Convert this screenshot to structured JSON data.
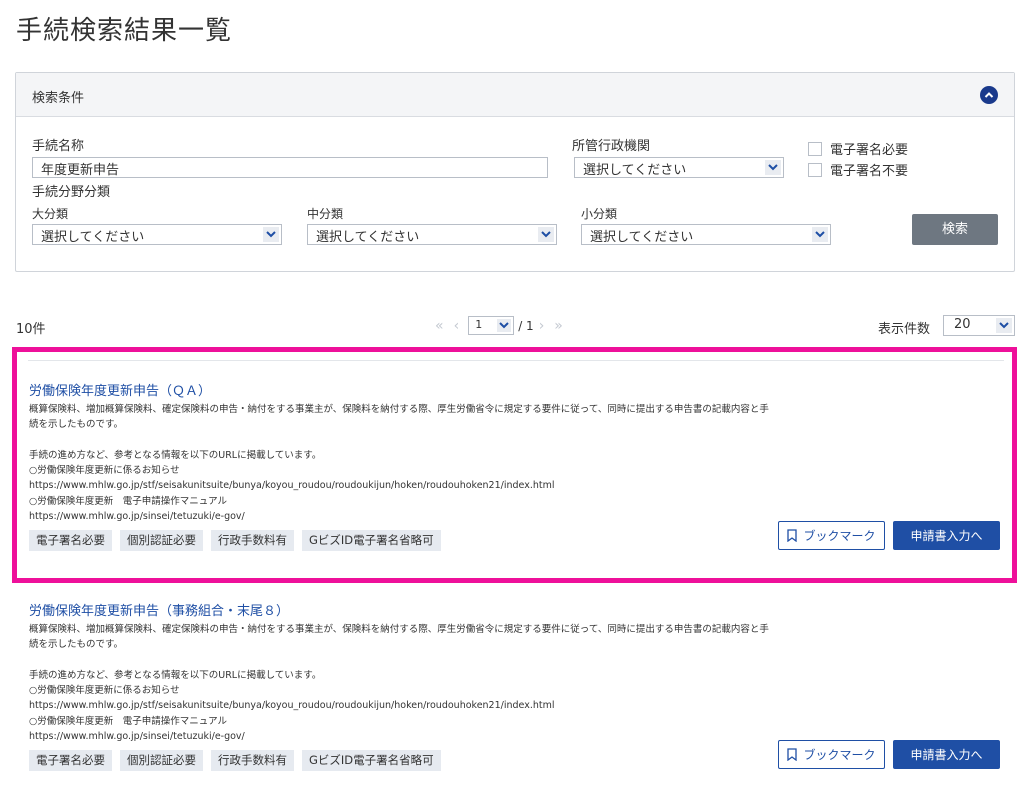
{
  "page_title": "手続検索結果一覧",
  "search_panel": {
    "title": "検索条件",
    "procedure_name_label": "手続名称",
    "procedure_name_value": "年度更新申告",
    "agency_label": "所管行政機関",
    "agency_value": "選択してください",
    "signature_required_label": "電子署名必要",
    "signature_not_required_label": "電子署名不要",
    "category_label": "手続分野分類",
    "major_label": "大分類",
    "major_value": "選択してください",
    "middle_label": "中分類",
    "middle_value": "選択してください",
    "minor_label": "小分類",
    "minor_value": "選択してください",
    "search_button": "検索"
  },
  "results_bar": {
    "count": "10件",
    "first_icon": "«",
    "prev_icon": "‹",
    "current_page": "1",
    "total_pages": "/ 1",
    "next_icon": "›",
    "last_icon": "»",
    "per_page_label": "表示件数",
    "per_page_value": "20"
  },
  "results": [
    {
      "title": "労働保険年度更新申告（ＱＡ）",
      "description": "概算保険料、増加概算保険料、確定保険料の申告・納付をする事業主が、保険料を納付する際、厚生労働省令に規定する要件に従って、同時に提出する申告書の記載内容と手続を示したものです。\n\n手続の進め方など、参考となる情報を以下のURLに掲載しています。\n○労働保険年度更新に係るお知らせ\nhttps://www.mhlw.go.jp/stf/seisakunitsuite/bunya/koyou_roudou/roudoukijun/hoken/roudouhoken21/index.html\n○労働保険年度更新　電子申請操作マニュアル\nhttps://www.mhlw.go.jp/sinsei/tetuzuki/e-gov/",
      "tags": [
        "電子署名必要",
        "個別認証必要",
        "行政手数料有",
        "GビズID電子署名省略可"
      ],
      "bookmark_label": "ブックマーク",
      "apply_label": "申請書入力へ"
    },
    {
      "title": "労働保険年度更新申告（事務組合・末尾８）",
      "description": "概算保険料、増加概算保険料、確定保険料の申告・納付をする事業主が、保険料を納付する際、厚生労働省令に規定する要件に従って、同時に提出する申告書の記載内容と手続を示したものです。\n\n手続の進め方など、参考となる情報を以下のURLに掲載しています。\n○労働保険年度更新に係るお知らせ\nhttps://www.mhlw.go.jp/stf/seisakunitsuite/bunya/koyou_roudou/roudoukijun/hoken/roudouhoken21/index.html\n○労働保険年度更新　電子申請操作マニュアル\nhttps://www.mhlw.go.jp/sinsei/tetuzuki/e-gov/",
      "tags": [
        "電子署名必要",
        "個別認証必要",
        "行政手数料有",
        "GビズID電子署名省略可"
      ],
      "bookmark_label": "ブックマーク",
      "apply_label": "申請書入力へ"
    }
  ],
  "colors": {
    "accent": "#1f4fa5",
    "highlight": "#ee109a"
  }
}
